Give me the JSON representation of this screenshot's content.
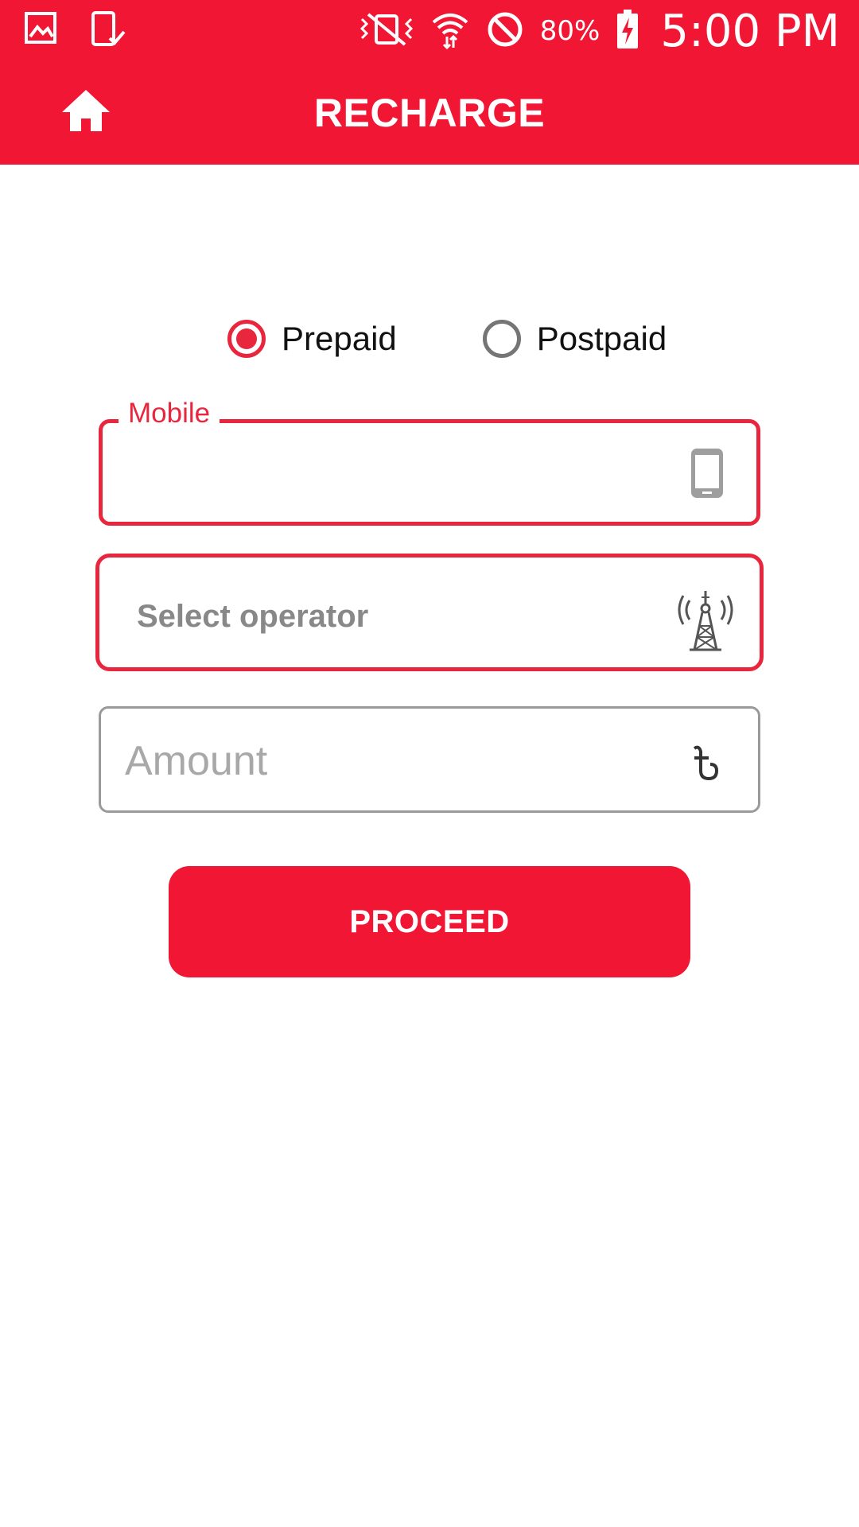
{
  "status_bar": {
    "battery_percent": "80%",
    "time": "5:00 PM",
    "icons": [
      "gallery-icon",
      "phone-check-icon",
      "vibrate-icon",
      "wifi-icon",
      "do-not-disturb-icon",
      "battery-charging-icon"
    ]
  },
  "app_bar": {
    "title": "RECHARGE",
    "home_icon": "home-icon"
  },
  "plan_type": {
    "options": [
      {
        "label": "Prepaid",
        "selected": true
      },
      {
        "label": "Postpaid",
        "selected": false
      }
    ]
  },
  "form": {
    "mobile": {
      "label": "Mobile",
      "value": "",
      "icon": "mobile-phone-icon"
    },
    "operator": {
      "placeholder": "Select operator",
      "icon": "cell-tower-icon"
    },
    "amount": {
      "placeholder": "Amount",
      "icon": "taka-currency-icon"
    }
  },
  "actions": {
    "proceed_label": "PROCEED"
  },
  "colors": {
    "primary": "#f01634",
    "accent": "#e8273f",
    "placeholder": "#a8a8a8"
  }
}
